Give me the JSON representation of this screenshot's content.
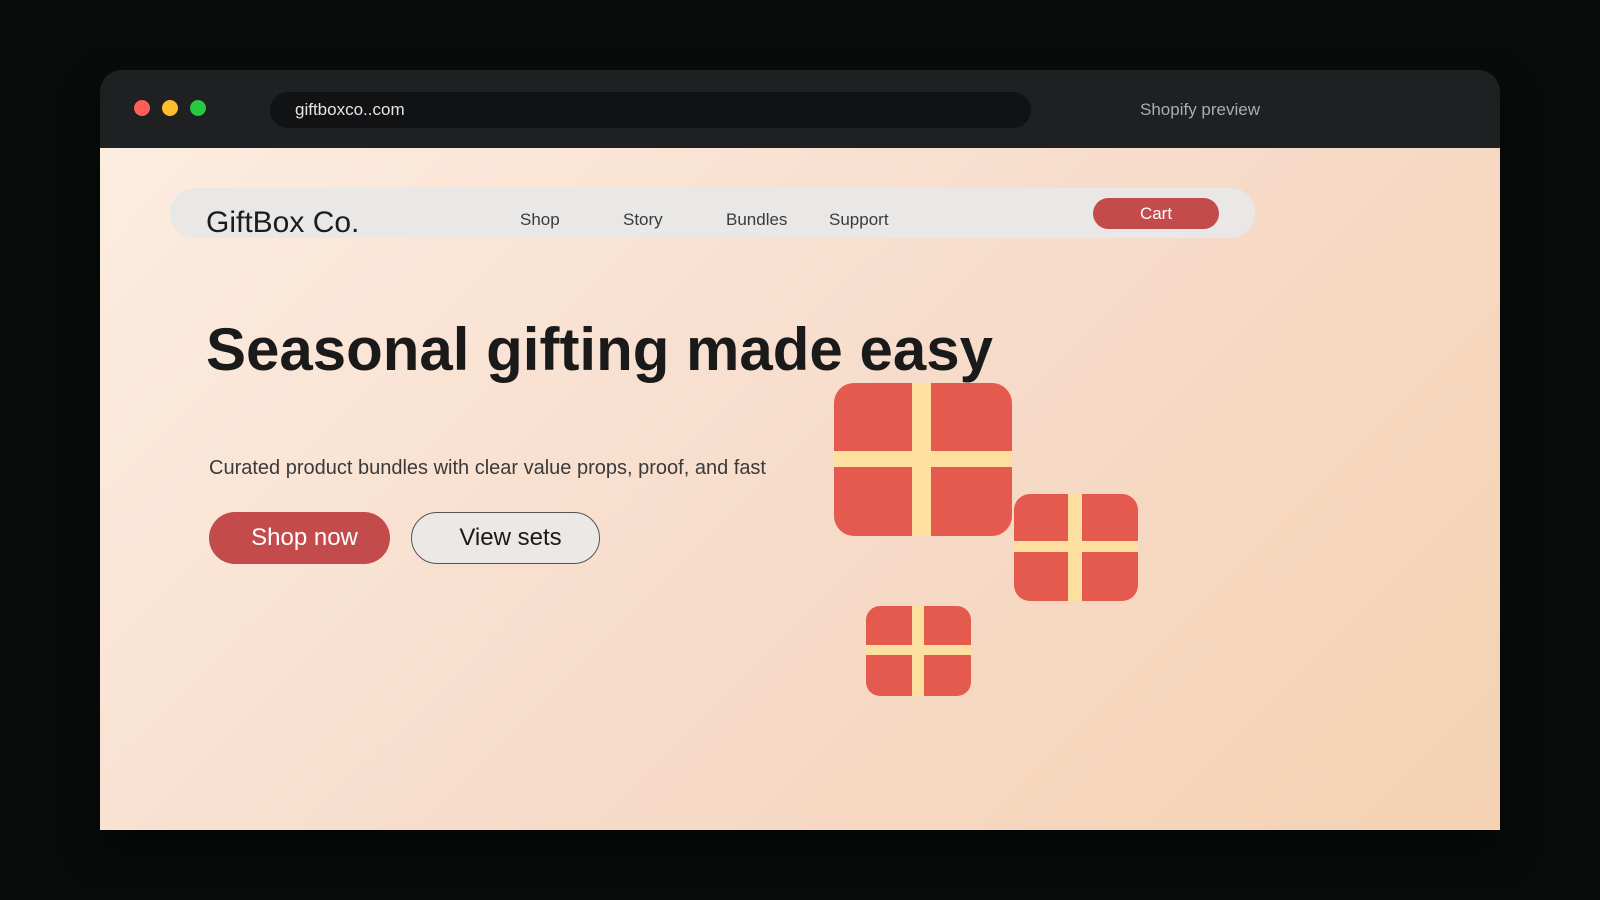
{
  "browser": {
    "url": "giftboxco..com",
    "label": "Shopify preview"
  },
  "nav": {
    "logo": "GiftBox Co.",
    "links": [
      "Shop",
      "Story",
      "Bundles",
      "Support"
    ],
    "cart_label": "Cart"
  },
  "hero": {
    "headline": "Seasonal gifting made easy",
    "subtext": "Curated product bundles with clear value props, proof, and fast",
    "primary_cta": "Shop now",
    "secondary_cta": "View sets"
  },
  "colors": {
    "accent": "#c44b4b",
    "gift_box": "#e55a4f",
    "ribbon": "#fde0a0",
    "page_gradient_start": "#fcede0",
    "page_gradient_end": "#f4d2b2"
  },
  "icons": [
    "gift-box-icon",
    "gift-box-icon",
    "gift-box-icon"
  ]
}
